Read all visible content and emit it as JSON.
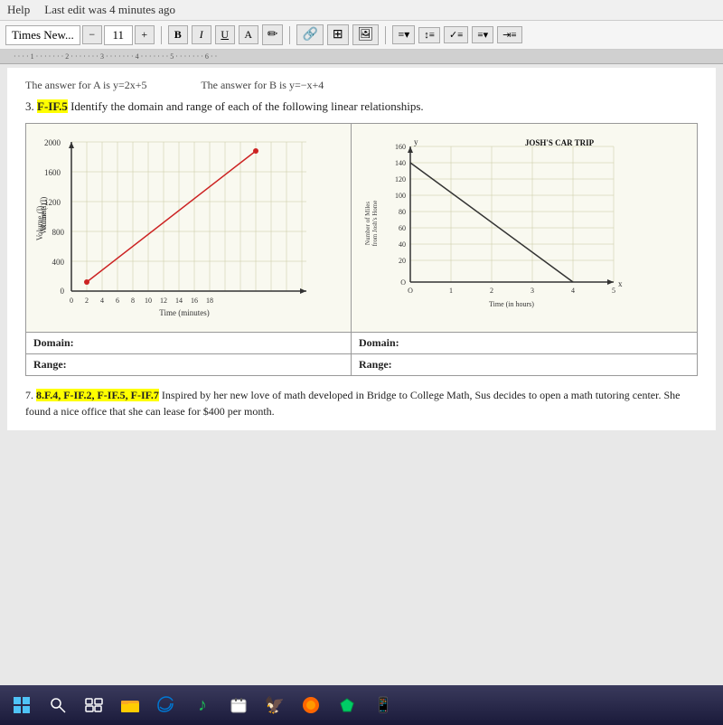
{
  "helpbar": {
    "help_label": "Help",
    "last_edit": "Last edit was 4 minutes ago"
  },
  "toolbar": {
    "font_name": "Times New...",
    "font_size": "11",
    "bold_label": "B",
    "italic_label": "I",
    "underline_label": "U",
    "minus_label": "−",
    "plus_label": "+"
  },
  "document": {
    "prev_answer_a": "The answer for A is y=2x+5",
    "prev_answer_b": "The answer for B is y=−x+4",
    "question3_label": "3.",
    "question3_tag": "F-IF.5",
    "question3_text": "Identify the domain and range of each of the following linear relationships.",
    "graph_left": {
      "title": "",
      "x_label": "Time (minutes)",
      "y_label": "Volume (l)",
      "x_values": [
        "0",
        "2",
        "4",
        "6",
        "8",
        "10",
        "12",
        "14",
        "16",
        "18"
      ],
      "y_values": [
        "400",
        "800",
        "1200",
        "1600",
        "2000"
      ]
    },
    "graph_right": {
      "title": "JOSH'S CAR TRIP",
      "x_label": "Time (in hours)",
      "y_label": "Number of Miles from Josh's Home",
      "x_values": [
        "1",
        "2",
        "3",
        "4",
        "5"
      ],
      "y_values": [
        "20",
        "40",
        "60",
        "80",
        "100",
        "120",
        "140",
        "160"
      ]
    },
    "domain_label": "Domain:",
    "range_label": "Range:",
    "domain_label_right": "Domain:",
    "range_label_right": "Range:",
    "question7_tag": "8.F.4, F-IF.2, F-IF.5, F-IF.7",
    "question7_label": "7.",
    "question7_text": "Inspired by her new love of math developed in Bridge to College Math, Sus decides to open a math tutoring center. She found a nice office that she can lease for $400 per month."
  },
  "taskbar": {
    "icons": [
      "⊞",
      "🔍",
      "📁",
      "🌐",
      "🎵",
      "📋",
      "🦅",
      "🟠",
      "💎",
      "📱"
    ]
  }
}
